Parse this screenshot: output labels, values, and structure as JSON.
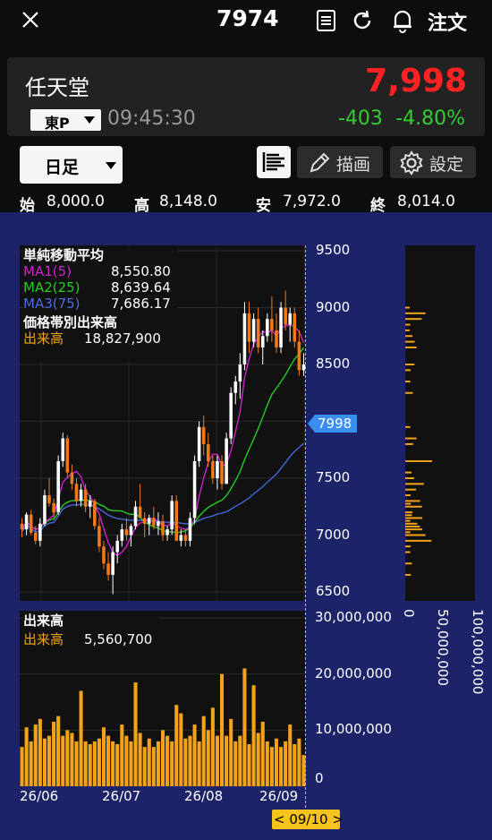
{
  "header": {
    "ticker": "7974",
    "order_label": "注文"
  },
  "stock": {
    "name": "任天堂",
    "price": "7,998",
    "change": "-403",
    "change_pct": "-4.80%",
    "market": "東P",
    "time": "09:45:30"
  },
  "controls": {
    "period": "日足",
    "draw_label": "描画",
    "settings_label": "設定"
  },
  "ohlc": {
    "open_label": "始",
    "open": "8,000.0",
    "high_label": "高",
    "high": "8,148.0",
    "low_label": "安",
    "low": "7,972.0",
    "close_label": "終",
    "close": "8,014.0"
  },
  "legend": {
    "ma_title": "単純移動平均",
    "ma1_label": "MA1(5)",
    "ma1_value": "8,550.80",
    "ma2_label": "MA2(25)",
    "ma2_value": "8,639.64",
    "ma3_label": "MA3(75)",
    "ma3_value": "7,686.17",
    "vp_title": "価格帯別出来高",
    "vp_label": "出来高",
    "vp_value": "18,827,900"
  },
  "volume_legend": {
    "title": "出来高",
    "label": "出来高",
    "value": "5,560,700"
  },
  "colors": {
    "up": "#ffffff",
    "down": "#f07a1a",
    "ma1": "#cc22cc",
    "ma2": "#22cc22",
    "ma3": "#4466dd",
    "volume": "#f2a21b",
    "price_down": "#ff2222",
    "change_down": "#33cc33"
  },
  "chart_data": {
    "type": "candlestick",
    "price_axis": {
      "ticks": [
        "9500",
        "9000",
        "8500",
        "8000",
        "7500",
        "7000",
        "6500"
      ],
      "ylim": [
        6500,
        9500
      ]
    },
    "volume_axis": {
      "ticks": [
        "30,000,000",
        "20,000,000",
        "10,000,000",
        "0"
      ],
      "ylim": [
        0,
        30000000
      ]
    },
    "profile_axis": {
      "ticks": [
        "0",
        "50,000,000",
        "100,000,000"
      ]
    },
    "x_ticks": [
      "26/06",
      "26/07",
      "26/08",
      "26/09"
    ],
    "current_price_tag": "7998",
    "cursor_label": "< 09/10 >",
    "candles": [
      [
        7100,
        7150,
        6980,
        7050
      ],
      [
        7050,
        7200,
        7000,
        7180
      ],
      [
        7180,
        7220,
        7000,
        7020
      ],
      [
        7020,
        7080,
        6920,
        6950
      ],
      [
        6950,
        7150,
        6900,
        7100
      ],
      [
        7100,
        7400,
        7080,
        7350
      ],
      [
        7350,
        7500,
        7250,
        7280
      ],
      [
        7280,
        7320,
        7150,
        7200
      ],
      [
        7200,
        7700,
        7180,
        7650
      ],
      [
        7650,
        7900,
        7600,
        7850
      ],
      [
        7850,
        7880,
        7500,
        7550
      ],
      [
        7550,
        7620,
        7400,
        7450
      ],
      [
        7450,
        7500,
        7250,
        7300
      ],
      [
        7300,
        7450,
        7250,
        7400
      ],
      [
        7400,
        7450,
        7200,
        7250
      ],
      [
        7250,
        7350,
        7150,
        7300
      ],
      [
        7300,
        7320,
        7050,
        7080
      ],
      [
        7080,
        7150,
        6850,
        6900
      ],
      [
        6900,
        6950,
        6700,
        6750
      ],
      [
        6750,
        6850,
        6600,
        6650
      ],
      [
        6650,
        6900,
        6480,
        6850
      ],
      [
        6850,
        7000,
        6750,
        6950
      ],
      [
        6950,
        7100,
        6900,
        7050
      ],
      [
        7050,
        7150,
        6950,
        7000
      ],
      [
        7000,
        7100,
        6900,
        7080
      ],
      [
        7080,
        7300,
        7050,
        7250
      ],
      [
        7250,
        7450,
        7200,
        7150
      ],
      [
        7150,
        7200,
        6980,
        7100
      ],
      [
        7100,
        7180,
        7000,
        7150
      ],
      [
        7150,
        7250,
        7050,
        7080
      ],
      [
        7080,
        7200,
        7000,
        7120
      ],
      [
        7120,
        7180,
        6950,
        7000
      ],
      [
        7000,
        7080,
        6950,
        7050
      ],
      [
        7050,
        7350,
        7000,
        7300
      ],
      [
        7300,
        7350,
        6950,
        6950
      ],
      [
        6950,
        7050,
        6900,
        7000
      ],
      [
        7000,
        7050,
        6900,
        6950
      ],
      [
        6950,
        7200,
        6900,
        7150
      ],
      [
        7150,
        7700,
        7100,
        7650
      ],
      [
        7650,
        8000,
        7600,
        7950
      ],
      [
        7950,
        8050,
        7700,
        7800
      ],
      [
        7800,
        7900,
        7600,
        7650
      ],
      [
        7650,
        7700,
        7450,
        7500
      ],
      [
        7500,
        7700,
        7400,
        7650
      ],
      [
        7650,
        7700,
        7400,
        7450
      ],
      [
        7450,
        7900,
        7450,
        7850
      ],
      [
        7850,
        8300,
        7800,
        8250
      ],
      [
        8250,
        8400,
        8150,
        8350
      ],
      [
        8350,
        8600,
        8200,
        8500
      ],
      [
        8500,
        9050,
        8450,
        8950
      ],
      [
        8950,
        9050,
        8600,
        8700
      ],
      [
        8700,
        8950,
        8650,
        8900
      ],
      [
        8900,
        9000,
        8600,
        8650
      ],
      [
        8650,
        8800,
        8500,
        8750
      ],
      [
        8750,
        8950,
        8700,
        8900
      ],
      [
        8900,
        9100,
        8700,
        8800
      ],
      [
        8800,
        8950,
        8600,
        8650
      ],
      [
        8650,
        9050,
        8600,
        9000
      ],
      [
        9000,
        9150,
        8800,
        8850
      ],
      [
        8850,
        9000,
        8700,
        8950
      ],
      [
        8950,
        9000,
        8650,
        8700
      ],
      [
        8700,
        8800,
        8400,
        8450
      ],
      [
        8450,
        8600,
        8400,
        8500
      ]
    ],
    "volumes": [
      7000000,
      10500000,
      8000000,
      11000000,
      12000000,
      8500000,
      9000000,
      11500000,
      12500000,
      9000000,
      10000000,
      9500000,
      8000000,
      17000000,
      8000000,
      7500000,
      8000000,
      8500000,
      10500000,
      9000000,
      8000000,
      7500000,
      11000000,
      9000000,
      8000000,
      18500000,
      9500000,
      7000000,
      8500000,
      7000000,
      8000000,
      10000000,
      9000000,
      8000000,
      14500000,
      13000000,
      8500000,
      9000000,
      11000000,
      8000000,
      12500000,
      10000000,
      14000000,
      9000000,
      20000000,
      9000000,
      12000000,
      8000000,
      9000000,
      21000000,
      7500000,
      18000000,
      9500000,
      11500000,
      8000000,
      7000000,
      8500000,
      7000000,
      8000000,
      11000000,
      7500000,
      8500000,
      5560700
    ]
  }
}
